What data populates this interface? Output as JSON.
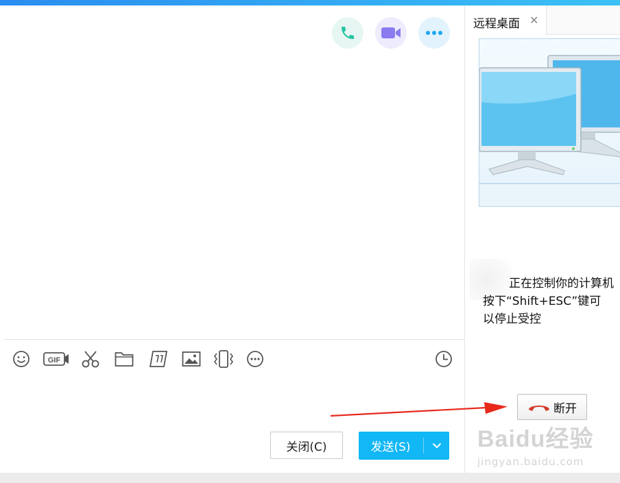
{
  "chat": {
    "header_actions": [
      {
        "name": "phone-call",
        "icon": "phone-icon",
        "color": "#26c4a2",
        "bg": "#e6f7f3"
      },
      {
        "name": "video-call",
        "icon": "video-camera-icon",
        "color": "#8a7cf0",
        "bg": "#eeecfc"
      },
      {
        "name": "more",
        "icon": "more-dots-icon",
        "color": "#1fa6f0",
        "bg": "#e2f3fd"
      }
    ],
    "toolbar": {
      "left_tools": [
        "emoji-icon",
        "gif-icon",
        "scissors-icon",
        "folder-icon",
        "graffiti-icon",
        "image-icon",
        "shake-icon",
        "more-icon"
      ],
      "gif_label": "GIF",
      "right_tool": "clock-icon"
    },
    "buttons": {
      "close_label": "关闭(C)",
      "send_label": "发送(S)",
      "send_dropdown_icon": "chevron-down-icon"
    },
    "accent_color": "#12b7f5"
  },
  "remote": {
    "tab_label": "远程桌面",
    "tab_close_icon": "close-icon",
    "status_lines": [
      "正在控制你的计算机",
      "按下“Shift+ESC”键可",
      "以停止受控"
    ],
    "disconnect_label": "断开",
    "disconnect_icon": "hangup-phone-icon",
    "disconnect_color": "#d23c2a"
  },
  "watermark": {
    "main": "Baidu经验",
    "sub": "jingyan.baidu.com"
  }
}
